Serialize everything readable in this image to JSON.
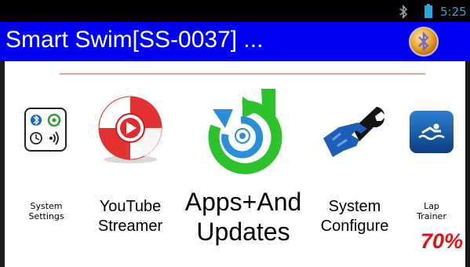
{
  "status_bar": {
    "time": "5:25",
    "icons": [
      "bluetooth-icon",
      "battery-icon"
    ]
  },
  "title_bar": {
    "title": "Smart Swim[SS-0037] ...",
    "action_icon": "bluetooth-orb-icon"
  },
  "apps": [
    {
      "label_lines": [
        "System",
        "Settings"
      ],
      "icon": "system-settings-icon"
    },
    {
      "label_lines": [
        "YouTube",
        "Streamer"
      ],
      "icon": "youtube-lifebuoy-icon"
    },
    {
      "label_lines": [
        "Apps+And",
        "Updates"
      ],
      "icon": "refresh-updates-icon"
    },
    {
      "label_lines": [
        "System",
        "Configure"
      ],
      "icon": "wrench-hand-icon"
    },
    {
      "label_lines": [
        "Lap",
        "Trainer"
      ],
      "icon": "swimmer-icon",
      "progress_text": "70%"
    }
  ],
  "colors": {
    "title_bar_bg": "#0000f5",
    "status_time": "#29a8e0",
    "progress_red": "#e01010",
    "refresh_green": "#2cc22c",
    "refresh_blue": "#2a8fd8"
  }
}
